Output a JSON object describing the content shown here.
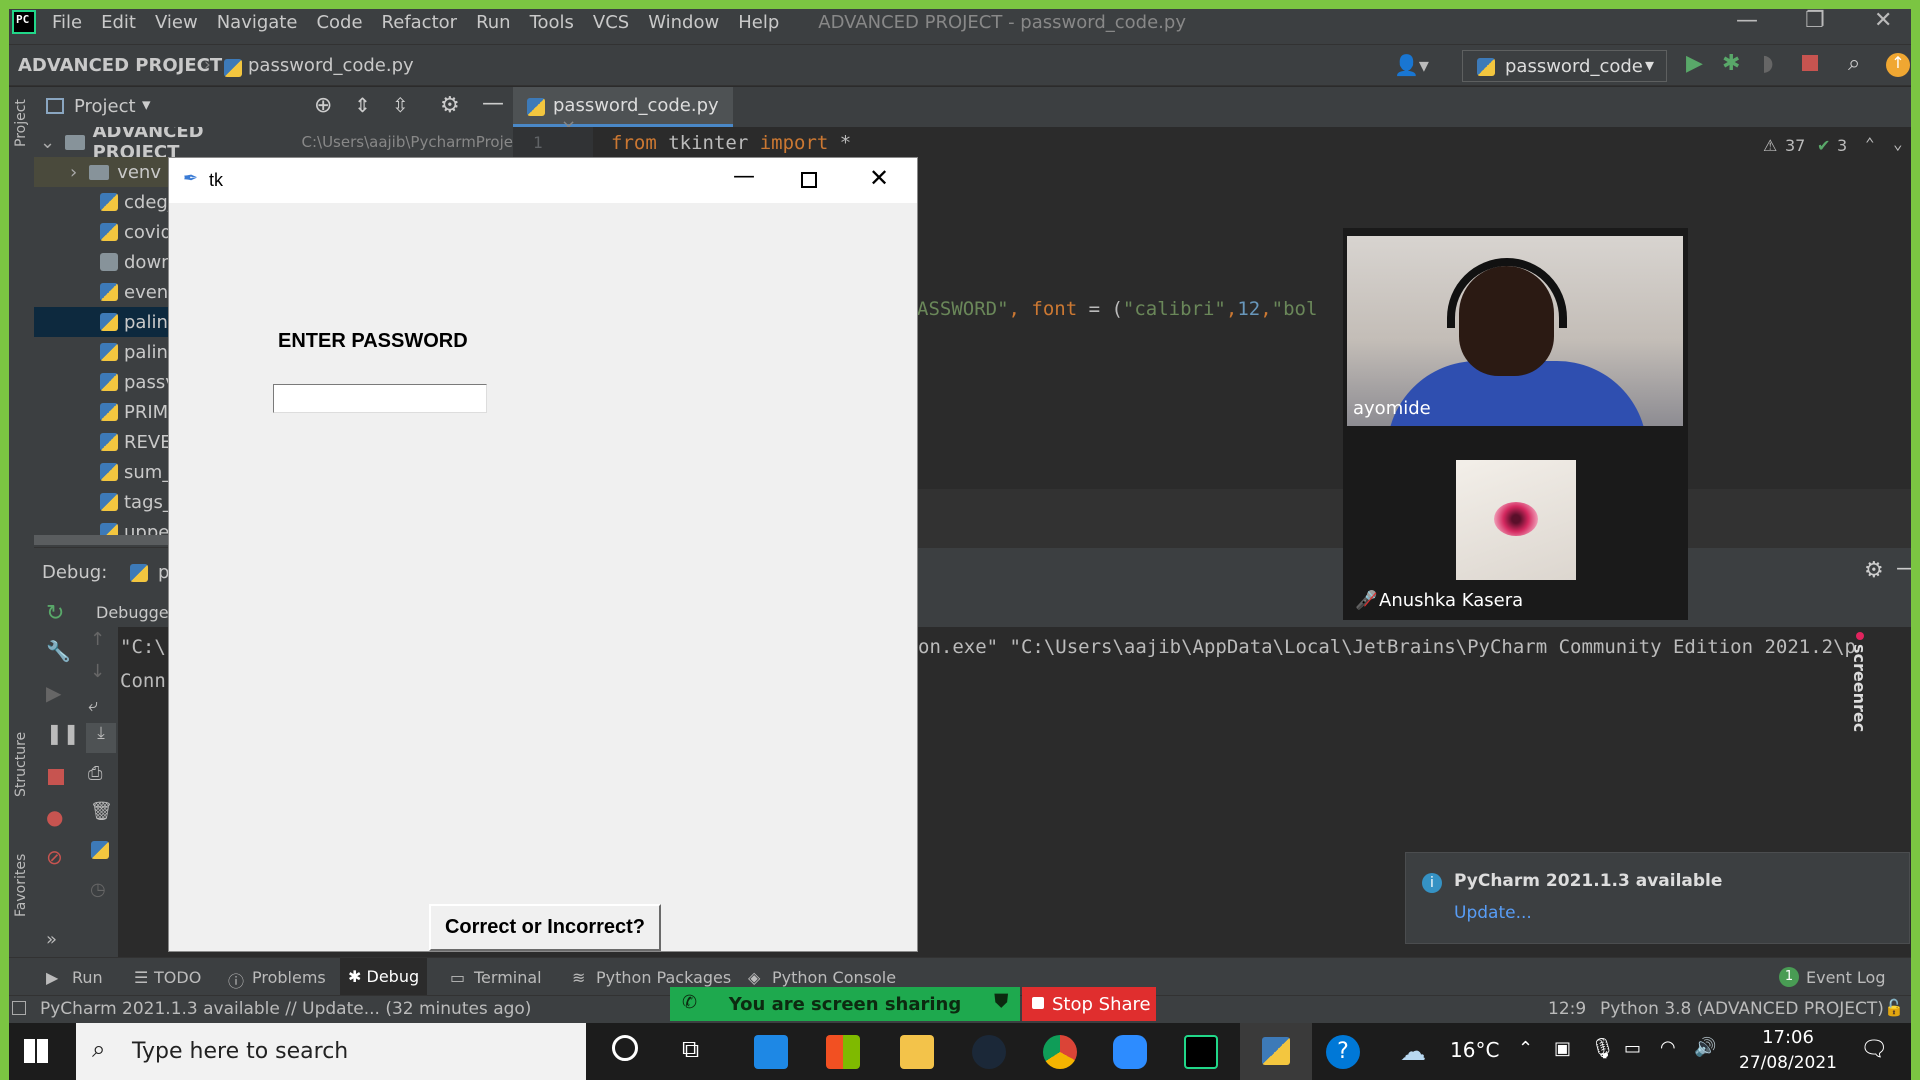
{
  "menubar": {
    "items": [
      "File",
      "Edit",
      "View",
      "Navigate",
      "Code",
      "Refactor",
      "Run",
      "Tools",
      "VCS",
      "Window",
      "Help"
    ],
    "title": "ADVANCED PROJECT - password_code.py"
  },
  "navbar": {
    "project": "ADVANCED PROJECT",
    "file": "password_code.py",
    "run_config": "password_code"
  },
  "project_panel": {
    "header": "Project",
    "root_label": "ADVANCED PROJECT",
    "root_path": "C:\\Users\\aajib\\PycharmProje",
    "items": [
      "venv",
      "cdeg_",
      "covid",
      "down",
      "even_",
      "palin",
      "palin",
      "passv",
      "PRIM",
      "REVE",
      "sum_",
      "tags_",
      "uppe"
    ]
  },
  "left_stripe": {
    "project": "Project",
    "structure": "Structure",
    "favorites": "Favorites"
  },
  "editor": {
    "tab": "password_code.py",
    "line_no": "1",
    "line1": {
      "from": "from",
      "module": " tkinter ",
      "import": "import",
      "star": " *"
    },
    "line2": {
      "str1": "ASSWORD\"",
      "font": ", font",
      "eq": " = (",
      "str2": "\"calibri\"",
      "comma": ",",
      "num": "12",
      "comma2": ",",
      "str3": "\"bol"
    },
    "warnings": "37",
    "checks": "3"
  },
  "debug": {
    "label": "Debug:",
    "tab": "p",
    "debugger_tab": "Debugger",
    "console_line1_left": "\"C:\\",
    "console_line2_left": "Conn",
    "console_line1_right": "on.exe\" \"C:\\Users\\aajib\\AppData\\Local\\JetBrains\\PyCharm Community Edition 2021.2\\p"
  },
  "bottom_tools": [
    "Run",
    "TODO",
    "Problems",
    "Debug",
    "Terminal",
    "Python Packages",
    "Python Console"
  ],
  "event_log": {
    "count": "1",
    "label": "Event Log"
  },
  "statusbar": {
    "message": "PyCharm 2021.1.3 available // Update... (32 minutes ago)",
    "position": "12:9",
    "interpreter": "Python 3.8 (ADVANCED PROJECT)"
  },
  "notification": {
    "title": "PyCharm 2021.1.3 available",
    "link": "Update..."
  },
  "zoom": {
    "sharing": "You are screen sharing",
    "stop": "Stop Share",
    "participant1": "ayomide",
    "participant2": "Anushka Kasera"
  },
  "screenrec": "screenrec",
  "tk": {
    "title": "tk",
    "label": "ENTER PASSWORD",
    "entry_value": "",
    "button": "Correct or Incorrect?"
  },
  "taskbar": {
    "search_placeholder": "Type here to search",
    "temperature": "16°C",
    "time": "17:06",
    "date": "27/08/2021"
  }
}
